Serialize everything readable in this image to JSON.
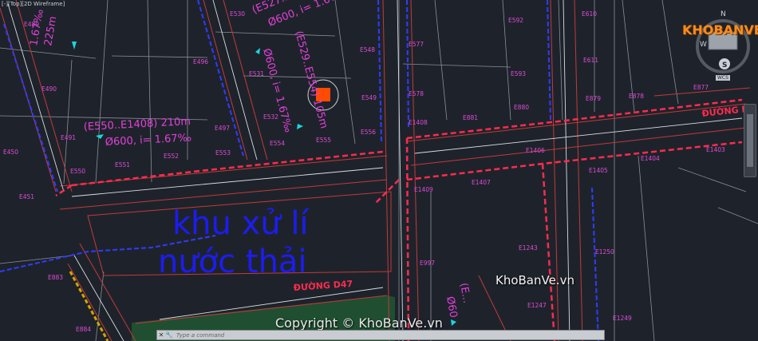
{
  "viewport": {
    "label": "[-][Top][2D Wireframe]"
  },
  "title_main": "khu xử lí",
  "title_sub": "nước thải",
  "road_labels": {
    "d47": "ĐƯỜNG D47",
    "d4": "ĐƯỜNG D4"
  },
  "pipe_labels": {
    "seg1": "(E550..E1408) 210m",
    "seg1_spec": "Ø600, i= 1.67‰",
    "seg2": "(E527..E540) 85m",
    "seg2_spec": "Ø600, i= 1.67‰",
    "seg3": "(E529..E554) 105m",
    "seg3_spec": "Ø600, i= 1.67‰",
    "seg_left": "225m",
    "seg_left_spec": "1.67‰",
    "seg_bottom": "(E...",
    "seg_bottom_spec": "Ø60"
  },
  "nodes": [
    {
      "id": "E489"
    },
    {
      "id": "E530"
    },
    {
      "id": "E496"
    },
    {
      "id": "E531"
    },
    {
      "id": "E490"
    },
    {
      "id": "E532"
    },
    {
      "id": "E491"
    },
    {
      "id": "E497"
    },
    {
      "id": "E553"
    },
    {
      "id": "E554"
    },
    {
      "id": "E555"
    },
    {
      "id": "E556"
    },
    {
      "id": "E450"
    },
    {
      "id": "E551"
    },
    {
      "id": "E552"
    },
    {
      "id": "E550"
    },
    {
      "id": "E451"
    },
    {
      "id": "E548"
    },
    {
      "id": "E549"
    },
    {
      "id": "E577"
    },
    {
      "id": "E578"
    },
    {
      "id": "E1408"
    },
    {
      "id": "E881"
    },
    {
      "id": "E592"
    },
    {
      "id": "E593"
    },
    {
      "id": "E880"
    },
    {
      "id": "E610"
    },
    {
      "id": "E611"
    },
    {
      "id": "E879"
    },
    {
      "id": "E878"
    },
    {
      "id": "E877"
    },
    {
      "id": "E1406"
    },
    {
      "id": "E1403"
    },
    {
      "id": "E1404"
    },
    {
      "id": "E1405"
    },
    {
      "id": "E1409"
    },
    {
      "id": "E1407"
    },
    {
      "id": "E997"
    },
    {
      "id": "E1243"
    },
    {
      "id": "E1250"
    },
    {
      "id": "E1247"
    },
    {
      "id": "E1249"
    },
    {
      "id": "E883"
    },
    {
      "id": "E884"
    }
  ],
  "compass": {
    "north": "N",
    "south": "S",
    "west": "W",
    "wcs": "WCS"
  },
  "logo": {
    "text": "KHOBANVE"
  },
  "watermark": {
    "site": "KhoBanVe.vn",
    "copyright": "Copyright © KhoBanVe.vn"
  },
  "command_line": {
    "placeholder": "Type a command",
    "btn_close": "✕",
    "btn_tools": "🔧"
  }
}
